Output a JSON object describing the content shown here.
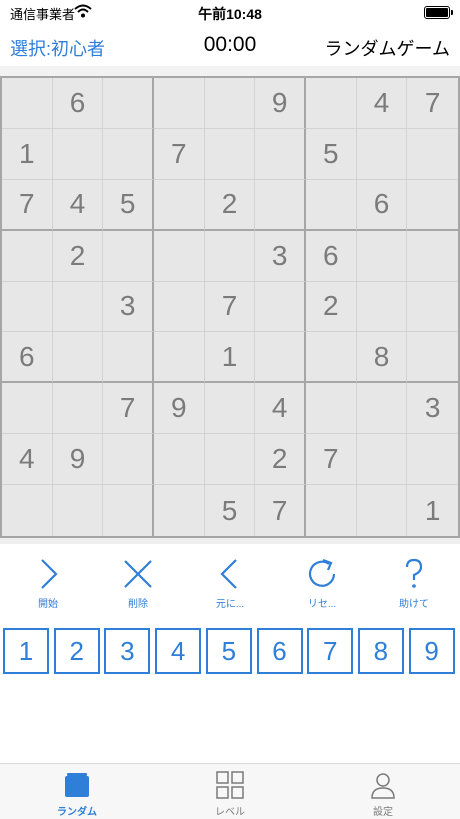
{
  "status_bar": {
    "carrier": "通信事業者",
    "time": "午前10:48"
  },
  "nav": {
    "left_label": "選択:初心者",
    "timer": "00:00",
    "right_label": "ランダムゲーム"
  },
  "grid": [
    [
      "",
      "6",
      "",
      "",
      "",
      "9",
      "",
      "4",
      "7"
    ],
    [
      "1",
      "",
      "",
      "7",
      "",
      "",
      "5",
      "",
      ""
    ],
    [
      "7",
      "4",
      "5",
      "",
      "2",
      "",
      "",
      "6",
      ""
    ],
    [
      "",
      "2",
      "",
      "",
      "",
      "3",
      "6",
      "",
      ""
    ],
    [
      "",
      "",
      "3",
      "",
      "7",
      "",
      "2",
      "",
      ""
    ],
    [
      "6",
      "",
      "",
      "",
      "1",
      "",
      "",
      "8",
      ""
    ],
    [
      "",
      "",
      "7",
      "9",
      "",
      "4",
      "",
      "",
      "3"
    ],
    [
      "4",
      "9",
      "",
      "",
      "",
      "2",
      "7",
      "",
      ""
    ],
    [
      "",
      "",
      "",
      "",
      "5",
      "7",
      "",
      "",
      "1"
    ]
  ],
  "actions": [
    {
      "label": "開始",
      "icon": "chevron-right-icon"
    },
    {
      "label": "削除",
      "icon": "cross-icon"
    },
    {
      "label": "元に...",
      "icon": "chevron-left-icon"
    },
    {
      "label": "リセ...",
      "icon": "refresh-icon"
    },
    {
      "label": "助けて",
      "icon": "question-icon"
    }
  ],
  "numpad": [
    "1",
    "2",
    "3",
    "4",
    "5",
    "6",
    "7",
    "8",
    "9"
  ],
  "tabs": [
    {
      "label": "ランダム",
      "icon": "folder-icon",
      "active": true
    },
    {
      "label": "レベル",
      "icon": "grid-icon",
      "active": false
    },
    {
      "label": "設定",
      "icon": "person-icon",
      "active": false
    }
  ],
  "colors": {
    "accent": "#2f7ed8",
    "cell_bg": "#e7e7e7",
    "given_digit": "#7b7b7b"
  }
}
